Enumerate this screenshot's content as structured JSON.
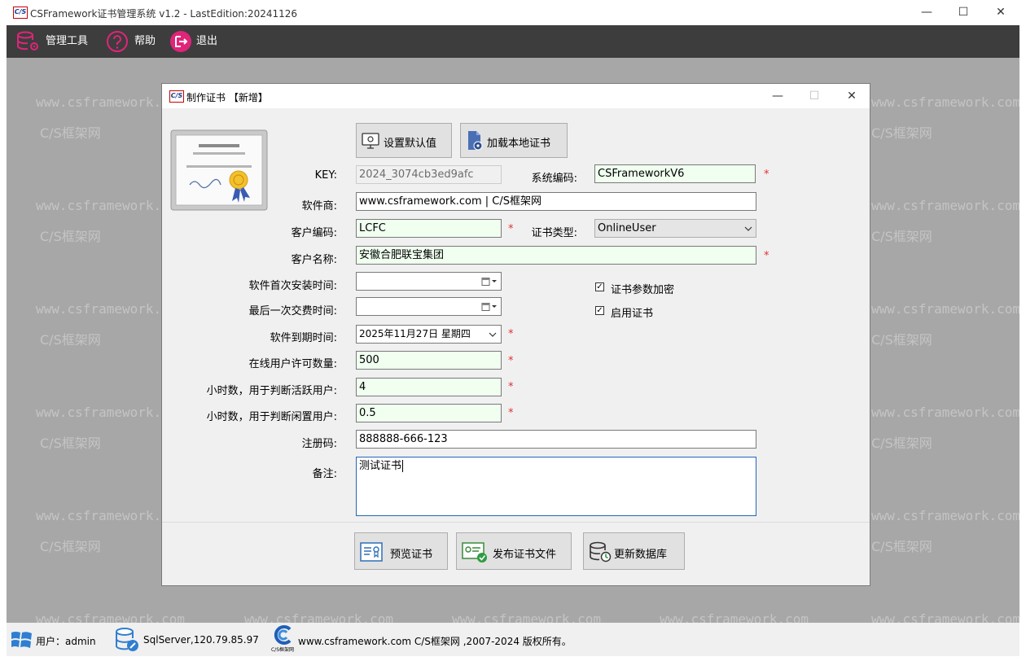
{
  "app": {
    "title": "CSFramework证书管理系统 v1.2 - LastEdition:20241126",
    "logo_text": "C/S"
  },
  "window_controls": {
    "minimize": "—",
    "maximize": "☐",
    "close": "✕"
  },
  "menu": {
    "items": [
      {
        "label": "管理工具",
        "icon": "database-gear-icon"
      },
      {
        "label": "帮助",
        "icon": "question-circle-icon"
      },
      {
        "label": "退出",
        "icon": "exit-icon"
      }
    ]
  },
  "watermark": {
    "url": "www.csframework.com",
    "name": "C/S框架网"
  },
  "dialog": {
    "title": "制作证书 【新增】",
    "buttons_top": {
      "defaults": "设置默认值",
      "load_local": "加载本地证书"
    },
    "labels": {
      "key": "KEY:",
      "system_code": "系统编码:",
      "vendor": "软件商:",
      "customer_code": "客户编码:",
      "cert_type": "证书类型:",
      "customer_name": "客户名称:",
      "first_install": "软件首次安装时间:",
      "last_payment": "最后一次交费时间:",
      "expiry": "软件到期时间:",
      "online_users": "在线用户许可数量:",
      "hours_active": "小时数，用于判断活跃用户:",
      "hours_idle": "小时数，用于判断闲置用户:",
      "reg_code": "注册码:",
      "remarks": "备注:"
    },
    "values": {
      "key": "2024_3074cb3ed9afc",
      "system_code": "CSFrameworkV6",
      "vendor": "www.csframework.com | C/S框架网",
      "customer_code": "LCFC",
      "cert_type": "OnlineUser",
      "customer_name": "安徽合肥联宝集团",
      "first_install": "",
      "last_payment": "",
      "expiry": "2025年11月27日 星期四",
      "online_users": "500",
      "hours_active": "4",
      "hours_idle": "0.5",
      "reg_code": "888888-666-123",
      "remarks": "测试证书"
    },
    "required_mark": "*",
    "checkboxes": [
      {
        "label": "证书参数加密",
        "checked": true
      },
      {
        "label": "启用证书",
        "checked": true
      }
    ],
    "check_glyph": "✓",
    "buttons_bottom": {
      "preview": "预览证书",
      "publish": "发布证书文件",
      "update_db": "更新数据库"
    }
  },
  "status": {
    "user": "用户：admin",
    "server": "SqlServer,120.79.85.97",
    "logo_caption": "C/S框架网",
    "copyright": "www.csframework.com C/S框架网 ,2007-2024 版权所有。"
  },
  "colors": {
    "accent_pink": "#e0247a",
    "menubar": "#3d3d3d",
    "workspace": "#a7a7a7",
    "required_bg": "#f0fff0",
    "star": "#e03030"
  }
}
